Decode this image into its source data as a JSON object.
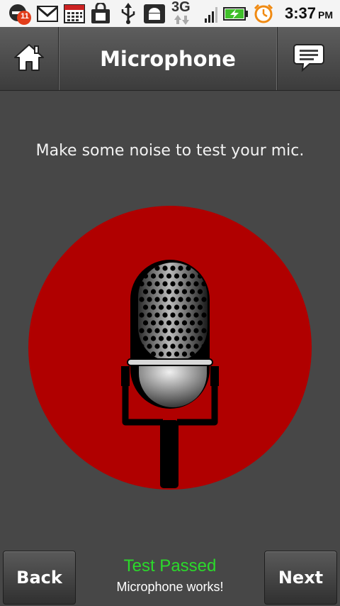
{
  "status_bar": {
    "notification_count": "11",
    "network": "3G",
    "time": "3:37",
    "ampm": "PM",
    "icons": [
      "notification-badge-icon",
      "gmail-icon",
      "calendar-icon",
      "market-icon",
      "usb-icon",
      "android-debug-icon",
      "network-3g-icon",
      "signal-icon",
      "battery-charging-icon",
      "alarm-icon"
    ]
  },
  "header": {
    "title": "Microphone",
    "home_icon": "home-icon",
    "chat_icon": "chat-icon"
  },
  "main": {
    "instruction": "Make some noise to test your mic.",
    "indicator_color": "#b00000"
  },
  "footer": {
    "back_label": "Back",
    "next_label": "Next",
    "status_title": "Test Passed",
    "status_subtitle": "Microphone works!",
    "status_color": "#2bd92b"
  }
}
